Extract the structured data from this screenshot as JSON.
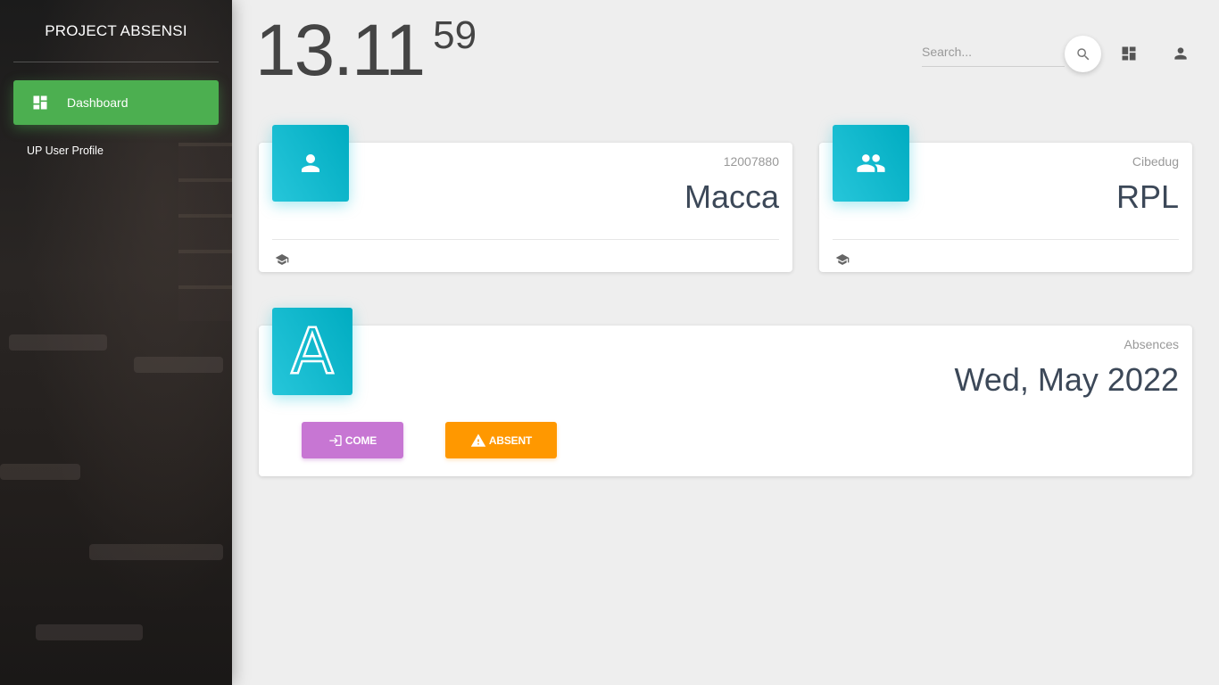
{
  "sidebar": {
    "brand": "PROJECT ABSENSI",
    "nav_active": {
      "label": "Dashboard",
      "icon": "dashboard-icon"
    },
    "nav_items": [
      {
        "label": "UP User Profile"
      }
    ],
    "active_color": "#4caf50"
  },
  "clock": {
    "hm": "13.11",
    "sec": "59"
  },
  "topbar": {
    "search_placeholder": "Search...",
    "icons": [
      "search-icon",
      "dashboard-icon",
      "person-icon"
    ]
  },
  "cards": {
    "student": {
      "category": "12007880",
      "title": "Macca",
      "icon": "person-icon",
      "footer_icon": "school-icon"
    },
    "class": {
      "category": "Cibedug",
      "title": "RPL",
      "icon": "group-icon",
      "footer_icon": "school-icon"
    },
    "absence": {
      "category": "Absences",
      "title": "Wed, May 2022",
      "icon_letter": "A",
      "come_label": "COME",
      "absent_label": "ABSENT",
      "come_color": "#c776d3",
      "absent_color": "#ff9800"
    },
    "icon_color": "#00acc1"
  }
}
